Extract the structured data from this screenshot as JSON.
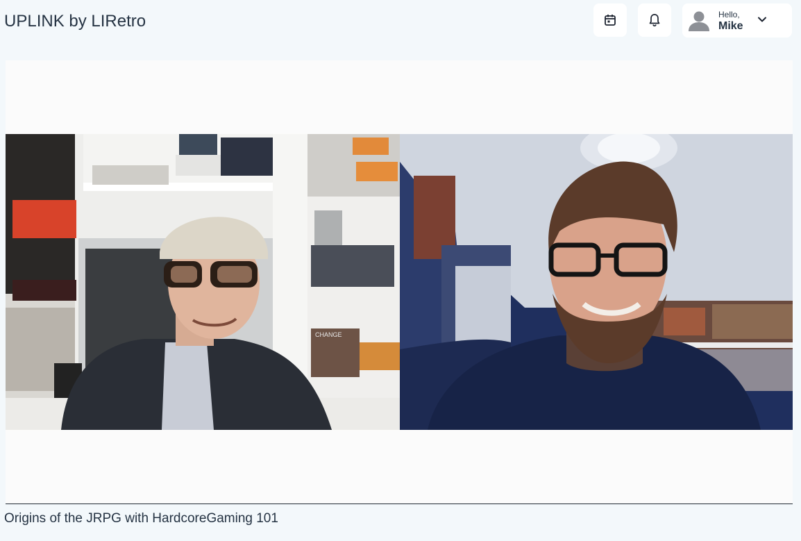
{
  "header": {
    "app_title": "UPLINK by LIRetro",
    "calendar_icon": "calendar-icon",
    "notifications_icon": "bell-icon",
    "user_menu": {
      "greeting": "Hello,",
      "name": "Mike",
      "avatar_icon": "user-avatar-icon",
      "dropdown_icon": "chevron-down-icon"
    }
  },
  "video": {
    "title": "Origins of the JRPG with HardcoreGaming 101",
    "participants_left_feed_text": "CHANGE"
  },
  "colors": {
    "background": "#f3f8fb",
    "text": "#253343",
    "card": "#ffffff"
  }
}
